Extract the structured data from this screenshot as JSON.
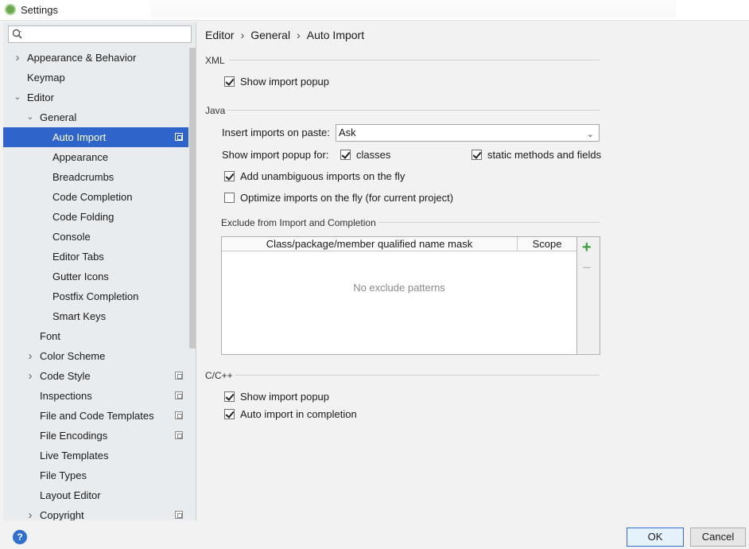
{
  "window": {
    "title": "Settings"
  },
  "search": {
    "placeholder": ""
  },
  "tree": [
    {
      "label": "Appearance & Behavior",
      "indent": 0,
      "chevron": "right",
      "proj": false,
      "selected": false
    },
    {
      "label": "Keymap",
      "indent": 0,
      "chevron": "",
      "proj": false,
      "selected": false
    },
    {
      "label": "Editor",
      "indent": 0,
      "chevron": "down",
      "proj": false,
      "selected": false
    },
    {
      "label": "General",
      "indent": 1,
      "chevron": "down",
      "proj": false,
      "selected": false
    },
    {
      "label": "Auto Import",
      "indent": 2,
      "chevron": "",
      "proj": true,
      "selected": true
    },
    {
      "label": "Appearance",
      "indent": 2,
      "chevron": "",
      "proj": false,
      "selected": false
    },
    {
      "label": "Breadcrumbs",
      "indent": 2,
      "chevron": "",
      "proj": false,
      "selected": false
    },
    {
      "label": "Code Completion",
      "indent": 2,
      "chevron": "",
      "proj": false,
      "selected": false
    },
    {
      "label": "Code Folding",
      "indent": 2,
      "chevron": "",
      "proj": false,
      "selected": false
    },
    {
      "label": "Console",
      "indent": 2,
      "chevron": "",
      "proj": false,
      "selected": false
    },
    {
      "label": "Editor Tabs",
      "indent": 2,
      "chevron": "",
      "proj": false,
      "selected": false
    },
    {
      "label": "Gutter Icons",
      "indent": 2,
      "chevron": "",
      "proj": false,
      "selected": false
    },
    {
      "label": "Postfix Completion",
      "indent": 2,
      "chevron": "",
      "proj": false,
      "selected": false
    },
    {
      "label": "Smart Keys",
      "indent": 2,
      "chevron": "",
      "proj": false,
      "selected": false
    },
    {
      "label": "Font",
      "indent": 1,
      "chevron": "",
      "proj": false,
      "selected": false
    },
    {
      "label": "Color Scheme",
      "indent": 1,
      "chevron": "right",
      "proj": false,
      "selected": false
    },
    {
      "label": "Code Style",
      "indent": 1,
      "chevron": "right",
      "proj": true,
      "selected": false
    },
    {
      "label": "Inspections",
      "indent": 1,
      "chevron": "",
      "proj": true,
      "selected": false
    },
    {
      "label": "File and Code Templates",
      "indent": 1,
      "chevron": "",
      "proj": true,
      "selected": false
    },
    {
      "label": "File Encodings",
      "indent": 1,
      "chevron": "",
      "proj": true,
      "selected": false
    },
    {
      "label": "Live Templates",
      "indent": 1,
      "chevron": "",
      "proj": false,
      "selected": false
    },
    {
      "label": "File Types",
      "indent": 1,
      "chevron": "",
      "proj": false,
      "selected": false
    },
    {
      "label": "Layout Editor",
      "indent": 1,
      "chevron": "",
      "proj": false,
      "selected": false
    },
    {
      "label": "Copyright",
      "indent": 1,
      "chevron": "right",
      "proj": true,
      "selected": false
    }
  ],
  "breadcrumb": {
    "items": [
      "Editor",
      "General",
      "Auto Import"
    ],
    "separator": "›"
  },
  "xml": {
    "title": "XML",
    "show_popup": {
      "label": "Show import popup",
      "checked": true
    }
  },
  "java": {
    "title": "Java",
    "insert_label": "Insert imports on paste:",
    "insert_value": "Ask",
    "popup_for_label": "Show import popup for:",
    "classes": {
      "label": "classes",
      "checked": true
    },
    "static": {
      "label": "static methods and fields",
      "checked": true
    },
    "unambiguous": {
      "label": "Add unambiguous imports on the fly",
      "checked": true
    },
    "optimize": {
      "label": "Optimize imports on the fly (for current project)",
      "checked": false
    },
    "exclude_title": "Exclude from Import and Completion",
    "col_mask": "Class/package/member qualified name mask",
    "col_scope": "Scope",
    "empty_text": "No exclude patterns",
    "add_label": "+",
    "remove_label": "−"
  },
  "cpp": {
    "title": "C/C++",
    "show_popup": {
      "label": "Show import popup",
      "checked": true
    },
    "auto_import": {
      "label": "Auto import in completion",
      "checked": true
    }
  },
  "footer": {
    "help": "?",
    "ok": "OK",
    "cancel": "Cancel"
  },
  "colors": {
    "selection": "#2f65ca",
    "add": "#3aa13a",
    "help": "#2f6fd1"
  }
}
